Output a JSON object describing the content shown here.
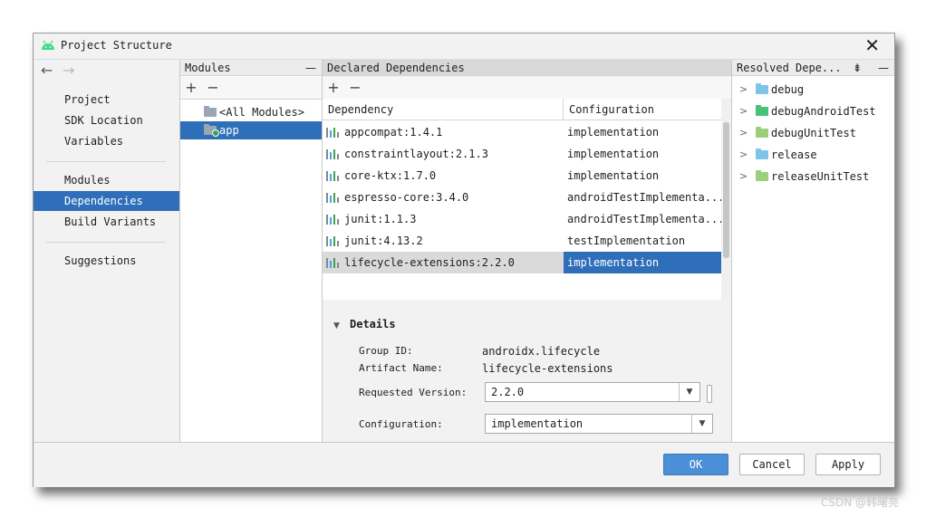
{
  "window": {
    "title": "Project Structure"
  },
  "nav": {
    "items_top": [
      "Project",
      "SDK Location",
      "Variables"
    ],
    "items_mid": [
      "Modules",
      "Dependencies",
      "Build Variants"
    ],
    "items_bottom": [
      "Suggestions"
    ],
    "selected": "Dependencies"
  },
  "modules": {
    "header": "Modules",
    "items": [
      "<All Modules>",
      "app"
    ],
    "selected": "app"
  },
  "declared": {
    "header": "Declared Dependencies",
    "columns": {
      "dependency": "Dependency",
      "configuration": "Configuration"
    },
    "rows": [
      {
        "name": "appcompat:1.4.1",
        "config": "implementation"
      },
      {
        "name": "constraintlayout:2.1.3",
        "config": "implementation"
      },
      {
        "name": "core-ktx:1.7.0",
        "config": "implementation"
      },
      {
        "name": "espresso-core:3.4.0",
        "config": "androidTestImplementa..."
      },
      {
        "name": "junit:1.1.3",
        "config": "androidTestImplementa..."
      },
      {
        "name": "junit:4.13.2",
        "config": "testImplementation"
      },
      {
        "name": "lifecycle-extensions:2.2.0",
        "config": "implementation"
      }
    ],
    "selected_index": 6
  },
  "details": {
    "title": "Details",
    "group_id_label": "Group ID:",
    "group_id": "androidx.lifecycle",
    "artifact_label": "Artifact Name:",
    "artifact": "lifecycle-extensions",
    "version_label": "Requested Version:",
    "version": "2.2.0",
    "configuration_label": "Configuration:",
    "configuration": "implementation"
  },
  "resolved": {
    "header": "Resolved Depe...",
    "items": [
      {
        "label": "debug",
        "color": "#7cc4e8"
      },
      {
        "label": "debugAndroidTest",
        "color": "#46c27a"
      },
      {
        "label": "debugUnitTest",
        "color": "#9bcf7a"
      },
      {
        "label": "release",
        "color": "#7cc4e8"
      },
      {
        "label": "releaseUnitTest",
        "color": "#9bcf7a"
      }
    ]
  },
  "footer": {
    "ok": "OK",
    "cancel": "Cancel",
    "apply": "Apply"
  },
  "watermark": "CSDN @韩曙亮",
  "colors": {
    "accent": "#2f6fba",
    "primary_button": "#4b8fd6"
  }
}
